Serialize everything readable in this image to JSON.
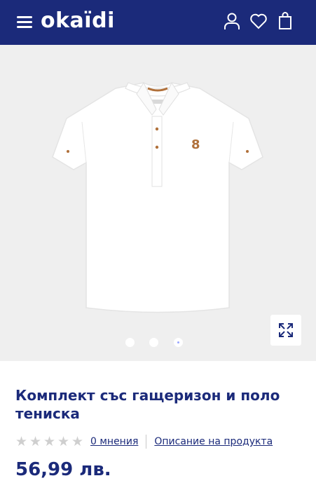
{
  "header": {
    "logo": "okaïdi",
    "menu_icon": "hamburger-menu-icon",
    "account_icon": "user-icon",
    "wishlist_icon": "heart-icon",
    "cart_icon": "shopping-bag-icon",
    "background": "#1b2a7a"
  },
  "gallery": {
    "slides": [
      "slide-1",
      "slide-2",
      "slide-3"
    ],
    "active_slide": 3,
    "zoom_icon": "expand-arrows-icon",
    "background": "#efefef"
  },
  "product": {
    "title": "Комплект със гащеризон и поло тениска",
    "rating": 0,
    "max_rating": 5,
    "reviews_label": "0 мнения",
    "description_link": "Описание на продукта",
    "price": "56,99 лв."
  },
  "colors": {
    "brand_navy": "#1b2a7a",
    "accent_brown": "#b0703a"
  }
}
